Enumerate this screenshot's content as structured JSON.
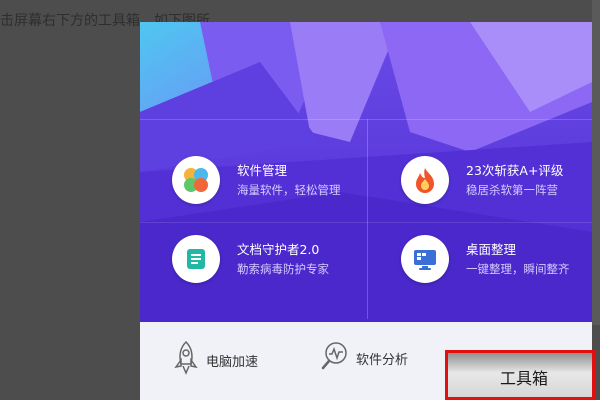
{
  "backdrop": {
    "instruction_text": "击屏幕右下方的工具箱，如下图所"
  },
  "tiles": [
    {
      "title": "软件管理",
      "subtitle": "海量软件，轻松管理",
      "icon": "colorful-flower-icon"
    },
    {
      "title": "23次斩获A+评级",
      "subtitle": "稳居杀软第一阵营",
      "icon": "fire-icon"
    },
    {
      "title": "文档守护者2.0",
      "subtitle": "勒索病毒防护专家",
      "icon": "document-icon"
    },
    {
      "title": "桌面整理",
      "subtitle": "一键整理，瞬间整齐",
      "icon": "monitor-icon"
    }
  ],
  "bottom_bar": {
    "items": [
      {
        "label": "电脑加速",
        "icon": "rocket-icon"
      },
      {
        "label": "软件分析",
        "icon": "magnifier-chart-icon"
      }
    ]
  },
  "toolbox": {
    "label": "工具箱"
  },
  "colors": {
    "panel_purple": "#6a3ce0",
    "highlight_border": "#e01010",
    "fire": "#f0552a",
    "doc_teal": "#22b8a5",
    "monitor_blue": "#3a6fd8"
  }
}
